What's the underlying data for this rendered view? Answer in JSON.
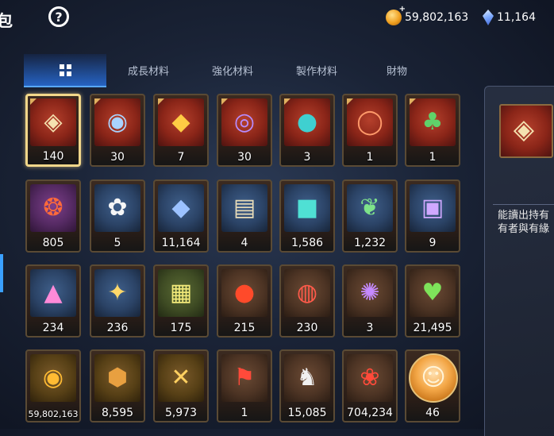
{
  "header": {
    "title_fragment": "包",
    "help_icon": "question-circle-icon",
    "currencies": [
      {
        "icon": "gold-coin-icon",
        "value": "59,802,163"
      },
      {
        "icon": "crystal-gem-icon",
        "value": "11,164"
      }
    ]
  },
  "tabs": [
    {
      "icon": "grid-icon",
      "label": "",
      "active": true
    },
    {
      "label": "成長材料",
      "active": false
    },
    {
      "label": "強化材料",
      "active": false
    },
    {
      "label": "製作材料",
      "active": false
    },
    {
      "label": "財物",
      "active": false
    }
  ],
  "items": [
    {
      "name": "eye-emblem",
      "count": "140",
      "bg": "red",
      "icon": "eye-emblem-icon",
      "selected": true
    },
    {
      "name": "winged-eye",
      "count": "30",
      "bg": "red",
      "icon": "winged-eye-icon"
    },
    {
      "name": "golden-shard",
      "count": "7",
      "bg": "red",
      "icon": "golden-shard-icon"
    },
    {
      "name": "rune-disc",
      "count": "30",
      "bg": "red",
      "icon": "rune-disc-icon"
    },
    {
      "name": "teal-pendant",
      "count": "3",
      "bg": "red",
      "icon": "teal-pendant-icon"
    },
    {
      "name": "blue-ring-pendant",
      "count": "1",
      "bg": "red",
      "icon": "ring-pendant-icon"
    },
    {
      "name": "tree-pendant",
      "count": "1",
      "bg": "red",
      "icon": "tree-pendant-icon"
    },
    {
      "name": "fire-bracelet",
      "count": "805",
      "bg": "purple",
      "icon": "bracelet-icon"
    },
    {
      "name": "white-lily",
      "count": "5",
      "bg": "blue",
      "icon": "lily-flower-icon"
    },
    {
      "name": "blue-crystal",
      "count": "11,164",
      "bg": "blue",
      "icon": "blue-crystal-icon"
    },
    {
      "name": "open-book",
      "count": "4",
      "bg": "blue",
      "icon": "open-book-icon"
    },
    {
      "name": "teal-cube",
      "count": "1,586",
      "bg": "blue",
      "icon": "teal-cube-icon"
    },
    {
      "name": "green-leaf",
      "count": "1,232",
      "bg": "blue",
      "icon": "leaf-icon"
    },
    {
      "name": "magic-card",
      "count": "9",
      "bg": "blue",
      "icon": "magic-card-icon"
    },
    {
      "name": "pink-gem-pile",
      "count": "234",
      "bg": "blue",
      "icon": "gem-pile-icon"
    },
    {
      "name": "star-compass",
      "count": "236",
      "bg": "blue",
      "icon": "star-compass-icon"
    },
    {
      "name": "character-card",
      "count": "175",
      "bg": "green",
      "icon": "character-card-icon"
    },
    {
      "name": "lava-orb",
      "count": "215",
      "bg": "brown",
      "icon": "lava-orb-icon"
    },
    {
      "name": "red-band",
      "count": "230",
      "bg": "brown",
      "icon": "red-band-icon"
    },
    {
      "name": "purple-seal",
      "count": "3",
      "bg": "brown",
      "icon": "purple-seal-icon"
    },
    {
      "name": "green-heart",
      "count": "21,495",
      "bg": "brown",
      "icon": "heart-icon"
    },
    {
      "name": "gold-coin",
      "count": "59,802,163",
      "bg": "gold",
      "icon": "gold-coin-icon",
      "small": true
    },
    {
      "name": "bronze-medal",
      "count": "8,595",
      "bg": "gold",
      "icon": "medal-icon"
    },
    {
      "name": "crossed-badge",
      "count": "5,973",
      "bg": "gold",
      "icon": "crossed-swords-badge-icon"
    },
    {
      "name": "war-banner",
      "count": "1",
      "bg": "brown",
      "icon": "banner-icon"
    },
    {
      "name": "chess-knight",
      "count": "15,085",
      "bg": "brown",
      "icon": "knight-piece-icon"
    },
    {
      "name": "red-crest",
      "count": "704,234",
      "bg": "brown",
      "icon": "red-crest-icon"
    },
    {
      "name": "hero-portrait",
      "count": "46",
      "bg": "round",
      "icon": "character-portrait-icon"
    }
  ],
  "detail": {
    "icon": "eye-emblem-icon",
    "description_line1": "能讀出持有",
    "description_line2": "有者與有緣"
  },
  "colors": {
    "accent_blue": "#3aa0ff",
    "selected_border": "#f1d78a"
  }
}
